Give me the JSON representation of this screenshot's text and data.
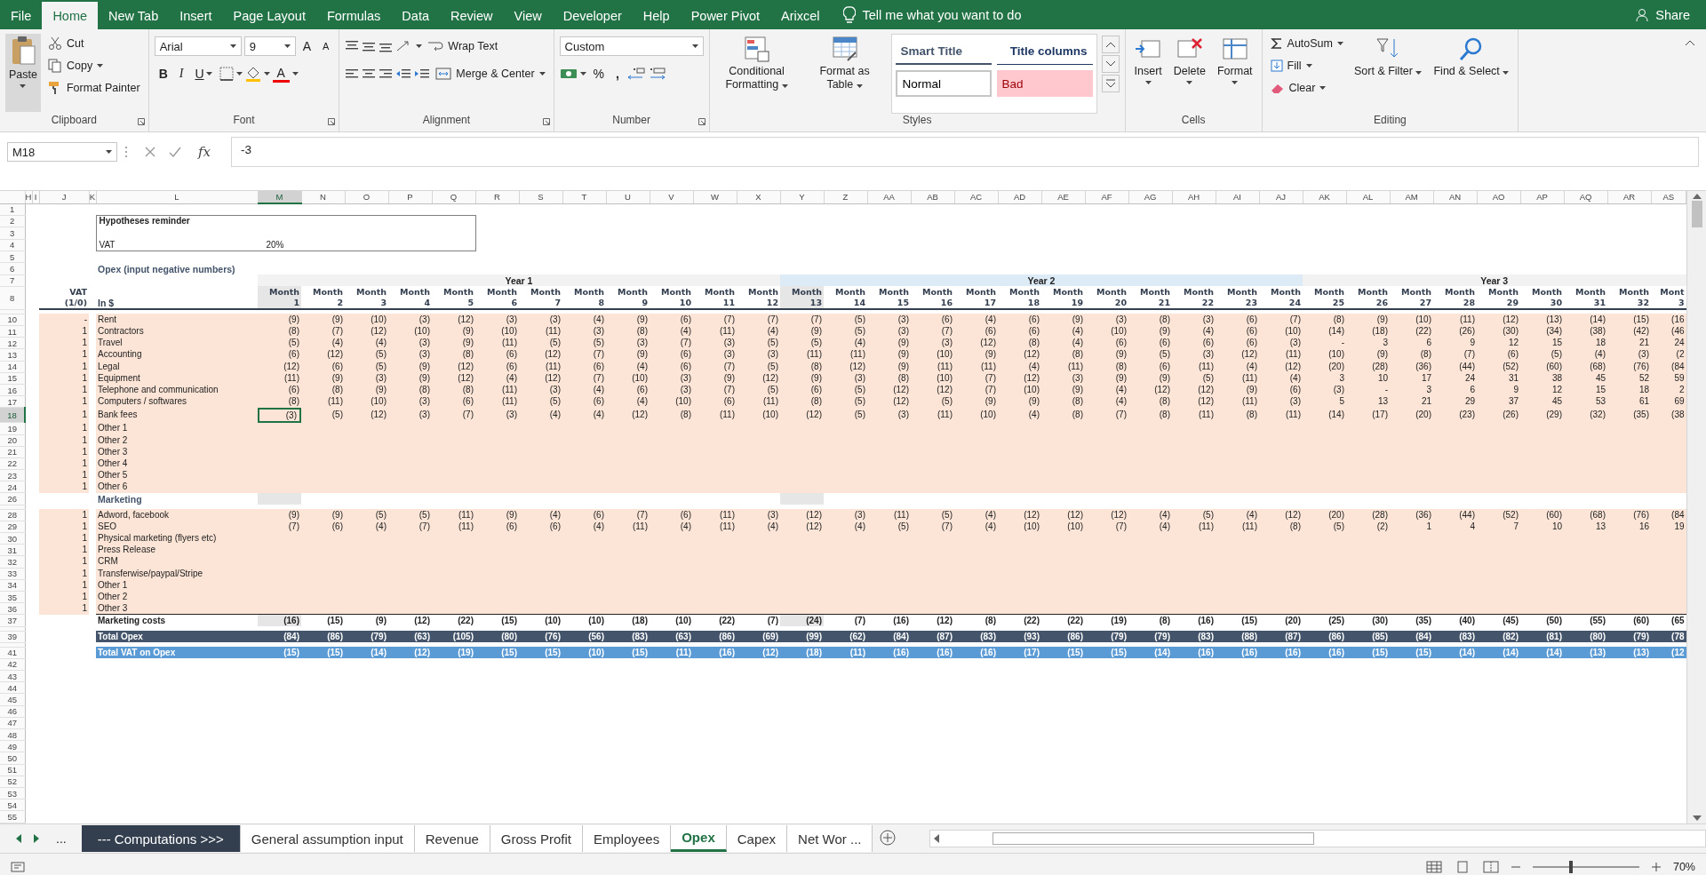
{
  "ribbon": {
    "tabs": [
      {
        "label": "File",
        "selected": false
      },
      {
        "label": "Home",
        "selected": true
      },
      {
        "label": "New Tab",
        "selected": false
      },
      {
        "label": "Insert",
        "selected": false
      },
      {
        "label": "Page Layout",
        "selected": false
      },
      {
        "label": "Formulas",
        "selected": false
      },
      {
        "label": "Data",
        "selected": false
      },
      {
        "label": "Review",
        "selected": false
      },
      {
        "label": "View",
        "selected": false
      },
      {
        "label": "Developer",
        "selected": false
      },
      {
        "label": "Help",
        "selected": false
      },
      {
        "label": "Power Pivot",
        "selected": false
      },
      {
        "label": "Arixcel",
        "selected": false
      }
    ],
    "tell_me": "Tell me what you want to do",
    "share": "Share",
    "groups": [
      {
        "kind": "clipboard",
        "label": "Clipboard",
        "paste": "Paste",
        "cut": "Cut",
        "copy": "Copy",
        "format_painter": "Format Painter"
      },
      {
        "kind": "font",
        "label": "Font",
        "family": "Arial",
        "size": "9",
        "grow": "A",
        "shrink": "A",
        "bold": "B",
        "italic": "I",
        "underline": "U",
        "font_color": "A"
      },
      {
        "kind": "alignment",
        "label": "Alignment",
        "wrap": "Wrap Text",
        "merge": "Merge & Center"
      },
      {
        "kind": "number",
        "label": "Number",
        "format": "Custom",
        "percent": "%",
        "comma": ","
      },
      {
        "kind": "styles",
        "label": "Styles",
        "conditional": "Conditional Formatting",
        "format_table": "Format as Table",
        "styles": [
          {
            "label": "Smart Title",
            "kind": "title"
          },
          {
            "label": "Title columns",
            "kind": "columns"
          },
          {
            "label": "Normal",
            "kind": "normal"
          },
          {
            "label": "Bad",
            "kind": "bad"
          }
        ]
      },
      {
        "kind": "cells",
        "label": "Cells",
        "buttons": [
          "Insert",
          "Delete",
          "Format"
        ]
      },
      {
        "kind": "editing",
        "label": "Editing",
        "autosum": "AutoSum",
        "fill": "Fill",
        "clear": "Clear",
        "sort": "Sort & Filter",
        "find": "Find & Select"
      }
    ]
  },
  "formula_bar": {
    "name_box": "M18",
    "function_button": "fx",
    "formula": "-3"
  },
  "sheet": {
    "columns": [
      {
        "letter": "H",
        "selected": false
      },
      {
        "letter": "I",
        "selected": false
      },
      {
        "letter": "J",
        "selected": false
      },
      {
        "letter": "K",
        "selected": false
      },
      {
        "letter": "L",
        "selected": false
      },
      {
        "letter": "M",
        "selected": true
      },
      {
        "letter": "N",
        "selected": false
      },
      {
        "letter": "O",
        "selected": false
      },
      {
        "letter": "P",
        "selected": false
      },
      {
        "letter": "Q",
        "selected": false
      },
      {
        "letter": "R",
        "selected": false
      },
      {
        "letter": "S",
        "selected": false
      },
      {
        "letter": "T",
        "selected": false
      },
      {
        "letter": "U",
        "selected": false
      },
      {
        "letter": "V",
        "selected": false
      },
      {
        "letter": "W",
        "selected": false
      },
      {
        "letter": "X",
        "selected": false
      },
      {
        "letter": "Y",
        "selected": false
      },
      {
        "letter": "Z",
        "selected": false
      },
      {
        "letter": "AA",
        "selected": false
      },
      {
        "letter": "AB",
        "selected": false
      },
      {
        "letter": "AC",
        "selected": false
      },
      {
        "letter": "AD",
        "selected": false
      },
      {
        "letter": "AE",
        "selected": false
      },
      {
        "letter": "AF",
        "selected": false
      },
      {
        "letter": "AG",
        "selected": false
      },
      {
        "letter": "AH",
        "selected": false
      },
      {
        "letter": "AI",
        "selected": false
      },
      {
        "letter": "AJ",
        "selected": false
      },
      {
        "letter": "AK",
        "selected": false
      },
      {
        "letter": "AL",
        "selected": false
      },
      {
        "letter": "AM",
        "selected": false
      },
      {
        "letter": "AN",
        "selected": false
      },
      {
        "letter": "AO",
        "selected": false
      },
      {
        "letter": "AP",
        "selected": false
      },
      {
        "letter": "AQ",
        "selected": false
      },
      {
        "letter": "AR",
        "selected": false
      },
      {
        "letter": "AS",
        "selected": false
      }
    ],
    "years": [
      {
        "label": "Year 1",
        "color": "#f2f2f2"
      },
      {
        "label": "Year 2",
        "color": "#ddebf7"
      },
      {
        "label": "Year 3",
        "color": "#f2f2f2"
      }
    ],
    "months": [
      {
        "label": "Month",
        "number": "1",
        "highlighted": true
      },
      {
        "label": "Month",
        "number": "2",
        "highlighted": false
      },
      {
        "label": "Month",
        "number": "3",
        "highlighted": false
      },
      {
        "label": "Month",
        "number": "4",
        "highlighted": false
      },
      {
        "label": "Month",
        "number": "5",
        "highlighted": false
      },
      {
        "label": "Month",
        "number": "6",
        "highlighted": false
      },
      {
        "label": "Month",
        "number": "7",
        "highlighted": false
      },
      {
        "label": "Month",
        "number": "8",
        "highlighted": false
      },
      {
        "label": "Month",
        "number": "9",
        "highlighted": false
      },
      {
        "label": "Month",
        "number": "10",
        "highlighted": false
      },
      {
        "label": "Month",
        "number": "11",
        "highlighted": false
      },
      {
        "label": "Month",
        "number": "12",
        "highlighted": false
      },
      {
        "label": "Month",
        "number": "13",
        "highlighted": true
      },
      {
        "label": "Month",
        "number": "14",
        "highlighted": false
      },
      {
        "label": "Month",
        "number": "15",
        "highlighted": false
      },
      {
        "label": "Month",
        "number": "16",
        "highlighted": false
      },
      {
        "label": "Month",
        "number": "17",
        "highlighted": false
      },
      {
        "label": "Month",
        "number": "18",
        "highlighted": false
      },
      {
        "label": "Month",
        "number": "19",
        "highlighted": false
      },
      {
        "label": "Month",
        "number": "20",
        "highlighted": false
      },
      {
        "label": "Month",
        "number": "21",
        "highlighted": false
      },
      {
        "label": "Month",
        "number": "22",
        "highlighted": false
      },
      {
        "label": "Month",
        "number": "23",
        "highlighted": false
      },
      {
        "label": "Month",
        "number": "24",
        "highlighted": false
      },
      {
        "label": "Month",
        "number": "25",
        "highlighted": false
      },
      {
        "label": "Month",
        "number": "26",
        "highlighted": false
      },
      {
        "label": "Month",
        "number": "27",
        "highlighted": false
      },
      {
        "label": "Month",
        "number": "28",
        "highlighted": false
      },
      {
        "label": "Month",
        "number": "29",
        "highlighted": false
      },
      {
        "label": "Month",
        "number": "30",
        "highlighted": false
      },
      {
        "label": "Month",
        "number": "31",
        "highlighted": false
      },
      {
        "label": "Month",
        "number": "32",
        "highlighted": false
      },
      {
        "label": "Mont",
        "number": "3",
        "highlighted": false
      }
    ],
    "rows": [
      {
        "n": "1",
        "selected": false,
        "kind": "blank"
      },
      {
        "n": "2",
        "selected": false,
        "kind": "box",
        "title": "Hypotheses reminder",
        "lines": [
          {
            "label": "VAT",
            "value": "20%"
          }
        ]
      },
      {
        "n": "3",
        "selected": false,
        "kind": "box_cont"
      },
      {
        "n": "4",
        "selected": false,
        "kind": "box_cont"
      },
      {
        "n": "5",
        "selected": false,
        "kind": "blank"
      },
      {
        "n": "6",
        "selected": false,
        "kind": "section",
        "label": "Opex (input negative numbers)"
      },
      {
        "n": "7",
        "selected": false,
        "kind": "year_header"
      },
      {
        "n": "8",
        "selected": false,
        "kind": "month_header",
        "vat_lines": [
          "VAT",
          "(1/0)"
        ],
        "label": "In $"
      },
      {
        "kind": "spacer"
      },
      {
        "n": "10",
        "selected": false,
        "kind": "item",
        "vat": "-",
        "label": "Rent",
        "values": [
          "(9)",
          "(9)",
          "(10)",
          "(3)",
          "(12)",
          "(3)",
          "(3)",
          "(4)",
          "(9)",
          "(6)",
          "(7)",
          "(7)",
          "(7)",
          "(5)",
          "(3)",
          "(6)",
          "(4)",
          "(6)",
          "(9)",
          "(3)",
          "(8)",
          "(3)",
          "(6)",
          "(7)",
          "(8)",
          "(9)",
          "(10)",
          "(11)",
          "(12)",
          "(13)",
          "(14)",
          "(15)",
          "(16"
        ]
      },
      {
        "n": "11",
        "selected": false,
        "kind": "item",
        "vat": "1",
        "label": "Contractors",
        "values": [
          "(8)",
          "(7)",
          "(12)",
          "(10)",
          "(9)",
          "(10)",
          "(11)",
          "(3)",
          "(8)",
          "(4)",
          "(11)",
          "(4)",
          "(9)",
          "(5)",
          "(3)",
          "(7)",
          "(6)",
          "(6)",
          "(4)",
          "(10)",
          "(9)",
          "(4)",
          "(6)",
          "(10)",
          "(14)",
          "(18)",
          "(22)",
          "(26)",
          "(30)",
          "(34)",
          "(38)",
          "(42)",
          "(46"
        ]
      },
      {
        "n": "12",
        "selected": false,
        "kind": "item",
        "vat": "1",
        "label": "Travel",
        "values": [
          "(5)",
          "(4)",
          "(4)",
          "(3)",
          "(9)",
          "(11)",
          "(5)",
          "(5)",
          "(3)",
          "(7)",
          "(3)",
          "(5)",
          "(5)",
          "(4)",
          "(9)",
          "(3)",
          "(12)",
          "(8)",
          "(4)",
          "(6)",
          "(6)",
          "(6)",
          "(6)",
          "(3)",
          "-",
          "3",
          "6",
          "9",
          "12",
          "15",
          "18",
          "21",
          "24"
        ]
      },
      {
        "n": "13",
        "selected": false,
        "kind": "item",
        "vat": "1",
        "label": "Accounting",
        "values": [
          "(6)",
          "(12)",
          "(5)",
          "(3)",
          "(8)",
          "(6)",
          "(12)",
          "(7)",
          "(9)",
          "(6)",
          "(3)",
          "(3)",
          "(11)",
          "(11)",
          "(9)",
          "(10)",
          "(9)",
          "(12)",
          "(8)",
          "(9)",
          "(5)",
          "(3)",
          "(12)",
          "(11)",
          "(10)",
          "(9)",
          "(8)",
          "(7)",
          "(6)",
          "(5)",
          "(4)",
          "(3)",
          "(2"
        ]
      },
      {
        "n": "14",
        "selected": false,
        "kind": "item",
        "vat": "1",
        "label": "Legal",
        "values": [
          "(12)",
          "(6)",
          "(5)",
          "(9)",
          "(12)",
          "(6)",
          "(11)",
          "(6)",
          "(4)",
          "(6)",
          "(7)",
          "(5)",
          "(8)",
          "(12)",
          "(9)",
          "(11)",
          "(11)",
          "(4)",
          "(11)",
          "(8)",
          "(6)",
          "(11)",
          "(4)",
          "(12)",
          "(20)",
          "(28)",
          "(36)",
          "(44)",
          "(52)",
          "(60)",
          "(68)",
          "(76)",
          "(84"
        ]
      },
      {
        "n": "15",
        "selected": false,
        "kind": "item",
        "vat": "1",
        "label": "Equipment",
        "values": [
          "(11)",
          "(9)",
          "(3)",
          "(9)",
          "(12)",
          "(4)",
          "(12)",
          "(7)",
          "(10)",
          "(3)",
          "(9)",
          "(12)",
          "(9)",
          "(3)",
          "(8)",
          "(10)",
          "(7)",
          "(12)",
          "(3)",
          "(9)",
          "(9)",
          "(5)",
          "(11)",
          "(4)",
          "3",
          "10",
          "17",
          "24",
          "31",
          "38",
          "45",
          "52",
          "59"
        ]
      },
      {
        "n": "16",
        "selected": false,
        "kind": "item",
        "vat": "1",
        "label": "Telephone and communication",
        "values": [
          "(6)",
          "(8)",
          "(9)",
          "(8)",
          "(8)",
          "(11)",
          "(3)",
          "(4)",
          "(6)",
          "(3)",
          "(7)",
          "(5)",
          "(6)",
          "(5)",
          "(12)",
          "(12)",
          "(7)",
          "(10)",
          "(9)",
          "(4)",
          "(12)",
          "(12)",
          "(9)",
          "(6)",
          "(3)",
          "-",
          "3",
          "6",
          "9",
          "12",
          "15",
          "18",
          "2"
        ]
      },
      {
        "n": "17",
        "selected": false,
        "kind": "item",
        "vat": "1",
        "label": "Computers / softwares",
        "values": [
          "(8)",
          "(11)",
          "(10)",
          "(3)",
          "(6)",
          "(11)",
          "(5)",
          "(6)",
          "(4)",
          "(10)",
          "(6)",
          "(11)",
          "(8)",
          "(5)",
          "(12)",
          "(5)",
          "(9)",
          "(9)",
          "(8)",
          "(4)",
          "(8)",
          "(12)",
          "(11)",
          "(3)",
          "5",
          "13",
          "21",
          "29",
          "37",
          "45",
          "53",
          "61",
          "69"
        ]
      },
      {
        "n": "18",
        "selected": true,
        "kind": "item",
        "vat": "1",
        "label": "Bank fees",
        "values": [
          "(3)",
          "(5)",
          "(12)",
          "(3)",
          "(7)",
          "(3)",
          "(4)",
          "(4)",
          "(12)",
          "(8)",
          "(11)",
          "(10)",
          "(12)",
          "(5)",
          "(3)",
          "(11)",
          "(10)",
          "(4)",
          "(8)",
          "(7)",
          "(8)",
          "(11)",
          "(8)",
          "(11)",
          "(14)",
          "(17)",
          "(20)",
          "(23)",
          "(26)",
          "(29)",
          "(32)",
          "(35)",
          "(38"
        ]
      },
      {
        "n": "19",
        "selected": false,
        "kind": "item",
        "vat": "1",
        "label": "Other 1"
      },
      {
        "n": "20",
        "selected": false,
        "kind": "item",
        "vat": "1",
        "label": "Other 2"
      },
      {
        "n": "21",
        "selected": false,
        "kind": "item",
        "vat": "1",
        "label": "Other 3"
      },
      {
        "n": "22",
        "selected": false,
        "kind": "item",
        "vat": "1",
        "label": "Other 4"
      },
      {
        "n": "23",
        "selected": false,
        "kind": "item",
        "vat": "1",
        "label": "Other 5"
      },
      {
        "n": "24",
        "selected": false,
        "kind": "item",
        "vat": "1",
        "label": "Other 6"
      },
      {
        "n": "26",
        "selected": false,
        "kind": "section",
        "label": "Marketing",
        "column_marks": true
      },
      {
        "kind": "spacer"
      },
      {
        "n": "28",
        "selected": false,
        "kind": "item",
        "vat": "1",
        "label": "Adword, facebook",
        "values": [
          "(9)",
          "(9)",
          "(5)",
          "(5)",
          "(11)",
          "(9)",
          "(4)",
          "(6)",
          "(7)",
          "(6)",
          "(11)",
          "(3)",
          "(12)",
          "(3)",
          "(11)",
          "(5)",
          "(4)",
          "(12)",
          "(12)",
          "(12)",
          "(4)",
          "(5)",
          "(4)",
          "(12)",
          "(20)",
          "(28)",
          "(36)",
          "(44)",
          "(52)",
          "(60)",
          "(68)",
          "(76)",
          "(84"
        ]
      },
      {
        "n": "29",
        "selected": false,
        "kind": "item",
        "vat": "1",
        "label": "SEO",
        "values": [
          "(7)",
          "(6)",
          "(4)",
          "(7)",
          "(11)",
          "(6)",
          "(6)",
          "(4)",
          "(11)",
          "(4)",
          "(11)",
          "(4)",
          "(12)",
          "(4)",
          "(5)",
          "(7)",
          "(4)",
          "(10)",
          "(10)",
          "(7)",
          "(4)",
          "(11)",
          "(11)",
          "(8)",
          "(5)",
          "(2)",
          "1",
          "4",
          "7",
          "10",
          "13",
          "16",
          "19"
        ]
      },
      {
        "n": "30",
        "selected": false,
        "kind": "item",
        "vat": "1",
        "label": "Physical marketing (flyers etc)"
      },
      {
        "n": "31",
        "selected": false,
        "kind": "item",
        "vat": "1",
        "label": "Press Release"
      },
      {
        "n": "32",
        "selected": false,
        "kind": "item",
        "vat": "1",
        "label": "CRM"
      },
      {
        "n": "33",
        "selected": false,
        "kind": "item",
        "vat": "1",
        "label": "Transferwise/paypal/Stripe"
      },
      {
        "n": "34",
        "selected": false,
        "kind": "item",
        "vat": "1",
        "label": "Other 1"
      },
      {
        "n": "35",
        "selected": false,
        "kind": "item",
        "vat": "1",
        "label": "Other 2"
      },
      {
        "n": "36",
        "selected": false,
        "kind": "item",
        "vat": "1",
        "label": "Other 3"
      },
      {
        "n": "37",
        "selected": false,
        "kind": "subtotal",
        "label": "Marketing costs",
        "values": [
          "(16)",
          "(15)",
          "(9)",
          "(12)",
          "(22)",
          "(15)",
          "(10)",
          "(10)",
          "(18)",
          "(10)",
          "(22)",
          "(7)",
          "(24)",
          "(7)",
          "(16)",
          "(12)",
          "(8)",
          "(22)",
          "(22)",
          "(19)",
          "(8)",
          "(16)",
          "(15)",
          "(20)",
          "(25)",
          "(30)",
          "(35)",
          "(40)",
          "(45)",
          "(50)",
          "(55)",
          "(60)",
          "(65"
        ]
      },
      {
        "kind": "spacer"
      },
      {
        "n": "39",
        "selected": false,
        "kind": "total",
        "label": "Total Opex",
        "values": [
          "(84)",
          "(86)",
          "(79)",
          "(63)",
          "(105)",
          "(80)",
          "(76)",
          "(56)",
          "(83)",
          "(63)",
          "(86)",
          "(69)",
          "(99)",
          "(62)",
          "(84)",
          "(87)",
          "(83)",
          "(93)",
          "(86)",
          "(79)",
          "(79)",
          "(83)",
          "(88)",
          "(87)",
          "(86)",
          "(85)",
          "(84)",
          "(83)",
          "(82)",
          "(81)",
          "(80)",
          "(79)",
          "(78"
        ]
      },
      {
        "kind": "spacer"
      },
      {
        "n": "41",
        "selected": false,
        "kind": "vat_total",
        "label": "Total VAT on Opex",
        "values": [
          "(15)",
          "(15)",
          "(14)",
          "(12)",
          "(19)",
          "(15)",
          "(15)",
          "(10)",
          "(15)",
          "(11)",
          "(16)",
          "(12)",
          "(18)",
          "(11)",
          "(16)",
          "(16)",
          "(16)",
          "(17)",
          "(15)",
          "(15)",
          "(14)",
          "(16)",
          "(16)",
          "(16)",
          "(16)",
          "(15)",
          "(15)",
          "(14)",
          "(14)",
          "(14)",
          "(13)",
          "(13)",
          "(12"
        ]
      },
      {
        "n": "42",
        "selected": false,
        "kind": "blank"
      },
      {
        "n": "43",
        "selected": false,
        "kind": "blank"
      },
      {
        "n": "44",
        "selected": false,
        "kind": "blank"
      },
      {
        "n": "45",
        "selected": false,
        "kind": "blank"
      },
      {
        "n": "46",
        "selected": false,
        "kind": "blank"
      },
      {
        "n": "47",
        "selected": false,
        "kind": "blank"
      },
      {
        "n": "48",
        "selected": false,
        "kind": "blank"
      },
      {
        "n": "49",
        "selected": false,
        "kind": "blank"
      },
      {
        "n": "50",
        "selected": false,
        "kind": "blank"
      },
      {
        "n": "51",
        "selected": false,
        "kind": "blank"
      },
      {
        "n": "52",
        "selected": false,
        "kind": "blank"
      },
      {
        "n": "53",
        "selected": false,
        "kind": "blank"
      },
      {
        "n": "54",
        "selected": false,
        "kind": "blank"
      },
      {
        "n": "55",
        "selected": false,
        "kind": "blank"
      }
    ]
  },
  "sheet_tabs": {
    "more": "...",
    "tabs": [
      {
        "label": "--- Computations >>>",
        "kind": "divider",
        "selected": false
      },
      {
        "label": "General assumption input",
        "kind": "sheet",
        "selected": false
      },
      {
        "label": "Revenue",
        "kind": "sheet",
        "selected": false
      },
      {
        "label": "Gross Profit",
        "kind": "sheet",
        "selected": false
      },
      {
        "label": "Employees",
        "kind": "sheet",
        "selected": false
      },
      {
        "label": "Opex",
        "kind": "sheet",
        "selected": true
      },
      {
        "label": "Capex",
        "kind": "sheet",
        "selected": false
      },
      {
        "label": "Net Wor ...",
        "kind": "sheet",
        "selected": false
      }
    ]
  },
  "status_bar": {
    "zoom": "70%",
    "level": 0.36
  }
}
